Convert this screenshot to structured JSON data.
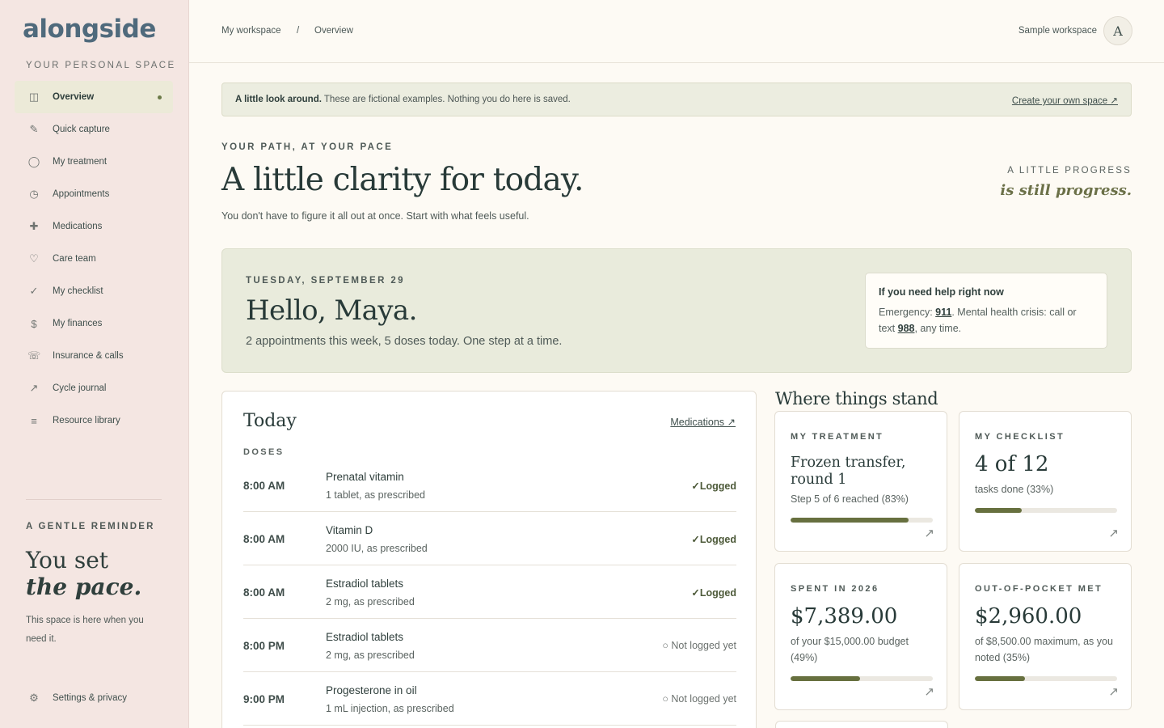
{
  "app": {
    "logo": "alongside",
    "caption": "YOUR PERSONAL SPACE"
  },
  "sidebar": {
    "items": [
      {
        "label": "Overview",
        "icon": "layout-icon",
        "glyph": "◫"
      },
      {
        "label": "Quick capture",
        "icon": "pencil-icon",
        "glyph": "✎"
      },
      {
        "label": "My treatment",
        "icon": "circle-icon",
        "glyph": "◯"
      },
      {
        "label": "Appointments",
        "icon": "clock-icon",
        "glyph": "◷"
      },
      {
        "label": "Medications",
        "icon": "plus-icon",
        "glyph": "✚"
      },
      {
        "label": "Care team",
        "icon": "heart-icon",
        "glyph": "♡"
      },
      {
        "label": "My checklist",
        "icon": "check-icon",
        "glyph": "✓"
      },
      {
        "label": "My finances",
        "icon": "dollar-icon",
        "glyph": "$"
      },
      {
        "label": "Insurance & calls",
        "icon": "phone-icon",
        "glyph": "☏"
      },
      {
        "label": "Cycle journal",
        "icon": "trend-arrow-icon",
        "glyph": "↗"
      },
      {
        "label": "Resource library",
        "icon": "list-icon",
        "glyph": "≡"
      }
    ],
    "reminder": {
      "caption": "A GENTLE REMINDER",
      "line1": "You set",
      "line2": "the pace.",
      "text": "This space is here when you need it."
    },
    "settings": {
      "label": "Settings & privacy",
      "glyph": "⚙"
    }
  },
  "topbar": {
    "crumb1": "My workspace",
    "separator": "/",
    "crumb2": "Overview",
    "workspace": "Sample workspace",
    "avatar": "A"
  },
  "banner": {
    "bold": "A little look around.",
    "text": " These are fictional examples. Nothing you do here is saved.",
    "link": "Create your own space ↗"
  },
  "hero": {
    "eyebrow": "YOUR PATH, AT YOUR PACE",
    "title": "A little clarity for today.",
    "subtitle": "You don't have to figure it all out at once. Start with what feels useful.",
    "progress_caption": "A LITTLE PROGRESS",
    "progress_quote": "is still progress."
  },
  "greeting": {
    "date": "TUESDAY, SEPTEMBER 29",
    "hello": "Hello, Maya.",
    "summary": "2 appointments this week, 5 doses today. One step at a time.",
    "help_title": "If you need help right now",
    "help_pre": "Emergency: ",
    "help_911": "911",
    "help_mid": ". Mental health crisis: call or text ",
    "help_988": "988",
    "help_post": ", any time."
  },
  "today": {
    "title": "Today",
    "link": "Medications ↗",
    "doses_caption": "DOSES",
    "doses": [
      {
        "time": "8:00 AM",
        "name": "Prenatal vitamin",
        "detail": "1 tablet, as prescribed",
        "status": "✓Logged",
        "logged": true
      },
      {
        "time": "8:00 AM",
        "name": "Vitamin D",
        "detail": "2000 IU, as prescribed",
        "status": "✓Logged",
        "logged": true
      },
      {
        "time": "8:00 AM",
        "name": "Estradiol tablets",
        "detail": "2 mg, as prescribed",
        "status": "✓Logged",
        "logged": true
      },
      {
        "time": "8:00 PM",
        "name": "Estradiol tablets",
        "detail": "2 mg, as prescribed",
        "status": "○ Not logged yet",
        "logged": false
      },
      {
        "time": "9:00 PM",
        "name": "Progesterone in oil",
        "detail": "1 mL injection, as prescribed",
        "status": "○ Not logged yet",
        "logged": false
      }
    ]
  },
  "stand": {
    "title": "Where things stand",
    "cards": [
      {
        "caption": "MY TREATMENT",
        "value": "Frozen transfer, round 1",
        "note": "Step 5 of 6 reached (83%)",
        "progress": 0.83
      },
      {
        "caption": "MY CHECKLIST",
        "value": "4 of 12",
        "note": "tasks done (33%)",
        "progress": 0.33
      },
      {
        "caption": "SPENT IN 2026",
        "value": "$7,389.00",
        "note": "of your $15,000.00 budget (49%)",
        "progress": 0.49
      },
      {
        "caption": "OUT-OF-POCKET MET",
        "value": "$2,960.00",
        "note": "of $8,500.00 maximum, as you noted (35%)",
        "progress": 0.35
      }
    ],
    "arrow": "↗"
  }
}
